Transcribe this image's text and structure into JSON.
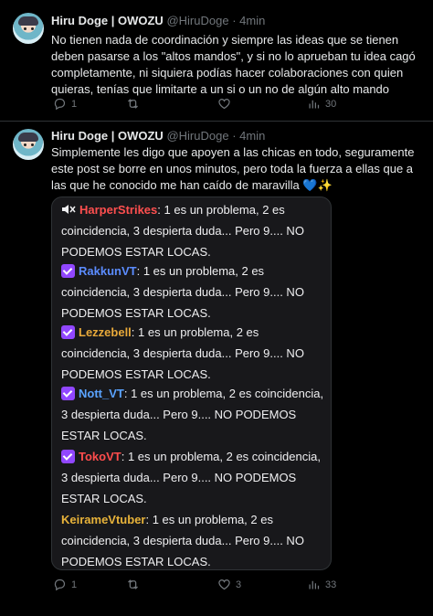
{
  "tweets": [
    {
      "name": "Hiru Doge | ",
      "name_suffix": "OWOZU",
      "handle": "@HiruDoge",
      "dot": "·",
      "time": "4min",
      "text": "No tienen nada de coordinación y siempre las ideas que se tienen deben pasarse a los \"altos mandos\", y si no lo aprueban tu idea cagó completamente, ni siquiera podías hacer colaboraciones con quien quieras, tenías que limitarte a un si o un no de algún alto mando",
      "replies": "1",
      "retweets": "",
      "likes": "",
      "views": "30"
    },
    {
      "name": "Hiru Doge | ",
      "name_suffix": "OWOZU",
      "handle": "@HiruDoge",
      "dot": "·",
      "time": "4min",
      "text": "Simplemente les digo que apoyen a las chicas en todo, seguramente este post se borre en unos minutos, pero toda la fuerza a ellas que a las que he conocido me han caído de maravilla",
      "emoji_text": "💙✨",
      "replies": "1",
      "retweets": "",
      "likes": "3",
      "views": "33"
    }
  ],
  "chat": {
    "messages": [
      {
        "user": "HarperStrikes",
        "color": "#ff4f4f",
        "badge": "mute",
        "text": "1 es un problema, 2 es coincidencia, 3 despierta duda... Pero 9.... NO PODEMOS ESTAR LOCAS."
      },
      {
        "user": "RakkunVT",
        "color": "#5b8cff",
        "badge": "check",
        "text": "1 es un problema, 2 es coincidencia, 3 despierta duda... Pero 9.... NO PODEMOS ESTAR LOCAS."
      },
      {
        "user": "Lezzebell",
        "color": "#e8a93a",
        "badge": "check",
        "text": "1 es un problema, 2 es coincidencia, 3 despierta duda... Pero 9.... NO PODEMOS ESTAR LOCAS."
      },
      {
        "user": "Nott_VT",
        "color": "#5aa3ff",
        "badge": "check",
        "text": "1 es un problema, 2 es coincidencia, 3 despierta duda... Pero 9.... NO PODEMOS ESTAR LOCAS."
      },
      {
        "user": "TokoVT",
        "color": "#ff4d4d",
        "badge": "check",
        "text": "1 es un problema, 2 es coincidencia, 3 despierta duda... Pero 9.... NO PODEMOS ESTAR LOCAS."
      },
      {
        "user": "KeirameVtuber",
        "color": "#e8b33a",
        "badge": "none",
        "text": "1 es un problema, 2 es coincidencia, 3 despierta duda... Pero 9.... NO PODEMOS ESTAR LOCAS."
      }
    ]
  },
  "colors": {
    "background": "#000000",
    "text": "#e7e9ea",
    "muted": "#71767b",
    "chat_bg": "#18181b",
    "badge": "#9147ff"
  },
  "icons": [
    "reply-icon",
    "retweet-icon",
    "like-icon",
    "views-icon",
    "mute-icon",
    "verified-badge-icon",
    "heart-icon"
  ]
}
